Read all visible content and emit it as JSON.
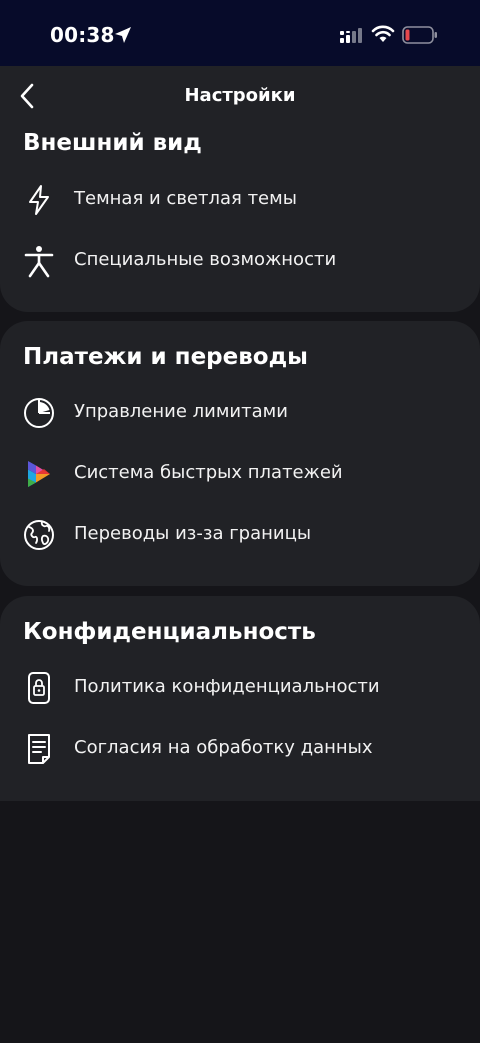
{
  "status": {
    "time": "00:38"
  },
  "header": {
    "title": "Настройки"
  },
  "sections": [
    {
      "title": "Внешний вид",
      "items": [
        {
          "label": "Темная и светлая темы",
          "icon": "lightning-icon"
        },
        {
          "label": "Специальные возможности",
          "icon": "accessibility-icon"
        }
      ]
    },
    {
      "title": "Платежи и переводы",
      "items": [
        {
          "label": "Управление лимитами",
          "icon": "pie-chart-icon"
        },
        {
          "label": "Система быстрых платежей",
          "icon": "sbp-logo-icon"
        },
        {
          "label": "Переводы из-за границы",
          "icon": "globe-icon"
        }
      ]
    },
    {
      "title": "Конфиденциальность",
      "items": [
        {
          "label": "Политика конфиденциальности",
          "icon": "phone-lock-icon"
        },
        {
          "label": "Согласия на обработку данных",
          "icon": "document-icon"
        }
      ]
    }
  ],
  "colors": {
    "status_bar_bg": "#070b2a",
    "page_bg": "#151519",
    "card_bg": "#212226",
    "battery_low": "#e5484d"
  }
}
